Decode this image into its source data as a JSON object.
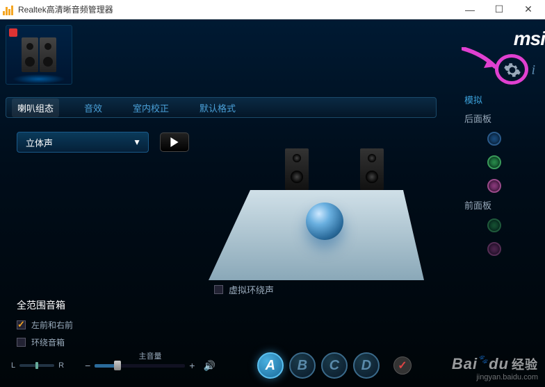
{
  "window": {
    "title": "Realtek高清晰音频管理器",
    "min": "—",
    "max": "☐",
    "close": "✕"
  },
  "logo": "msi",
  "side": {
    "mode": "模拟",
    "rear": "后面板",
    "front": "前面板"
  },
  "tabs": {
    "speaker_config": "喇叭组态",
    "effects": "音效",
    "room_correction": "室内校正",
    "default_format": "默认格式"
  },
  "dropdown": {
    "selected": "立体声"
  },
  "section": {
    "title": "全范围音箱",
    "front_pair": "左前和右前",
    "surround": "环绕音箱",
    "virtual": "虚拟环绕声"
  },
  "volume": {
    "label": "主音量",
    "left": "L",
    "right": "R",
    "minus": "−",
    "plus": "+"
  },
  "letters": {
    "a": "A",
    "b": "B",
    "c": "C",
    "d": "D"
  },
  "watermark": {
    "brand": "Bai",
    "brand2": "du",
    "cn": "经验",
    "url": "jingyan.baidu.com"
  }
}
